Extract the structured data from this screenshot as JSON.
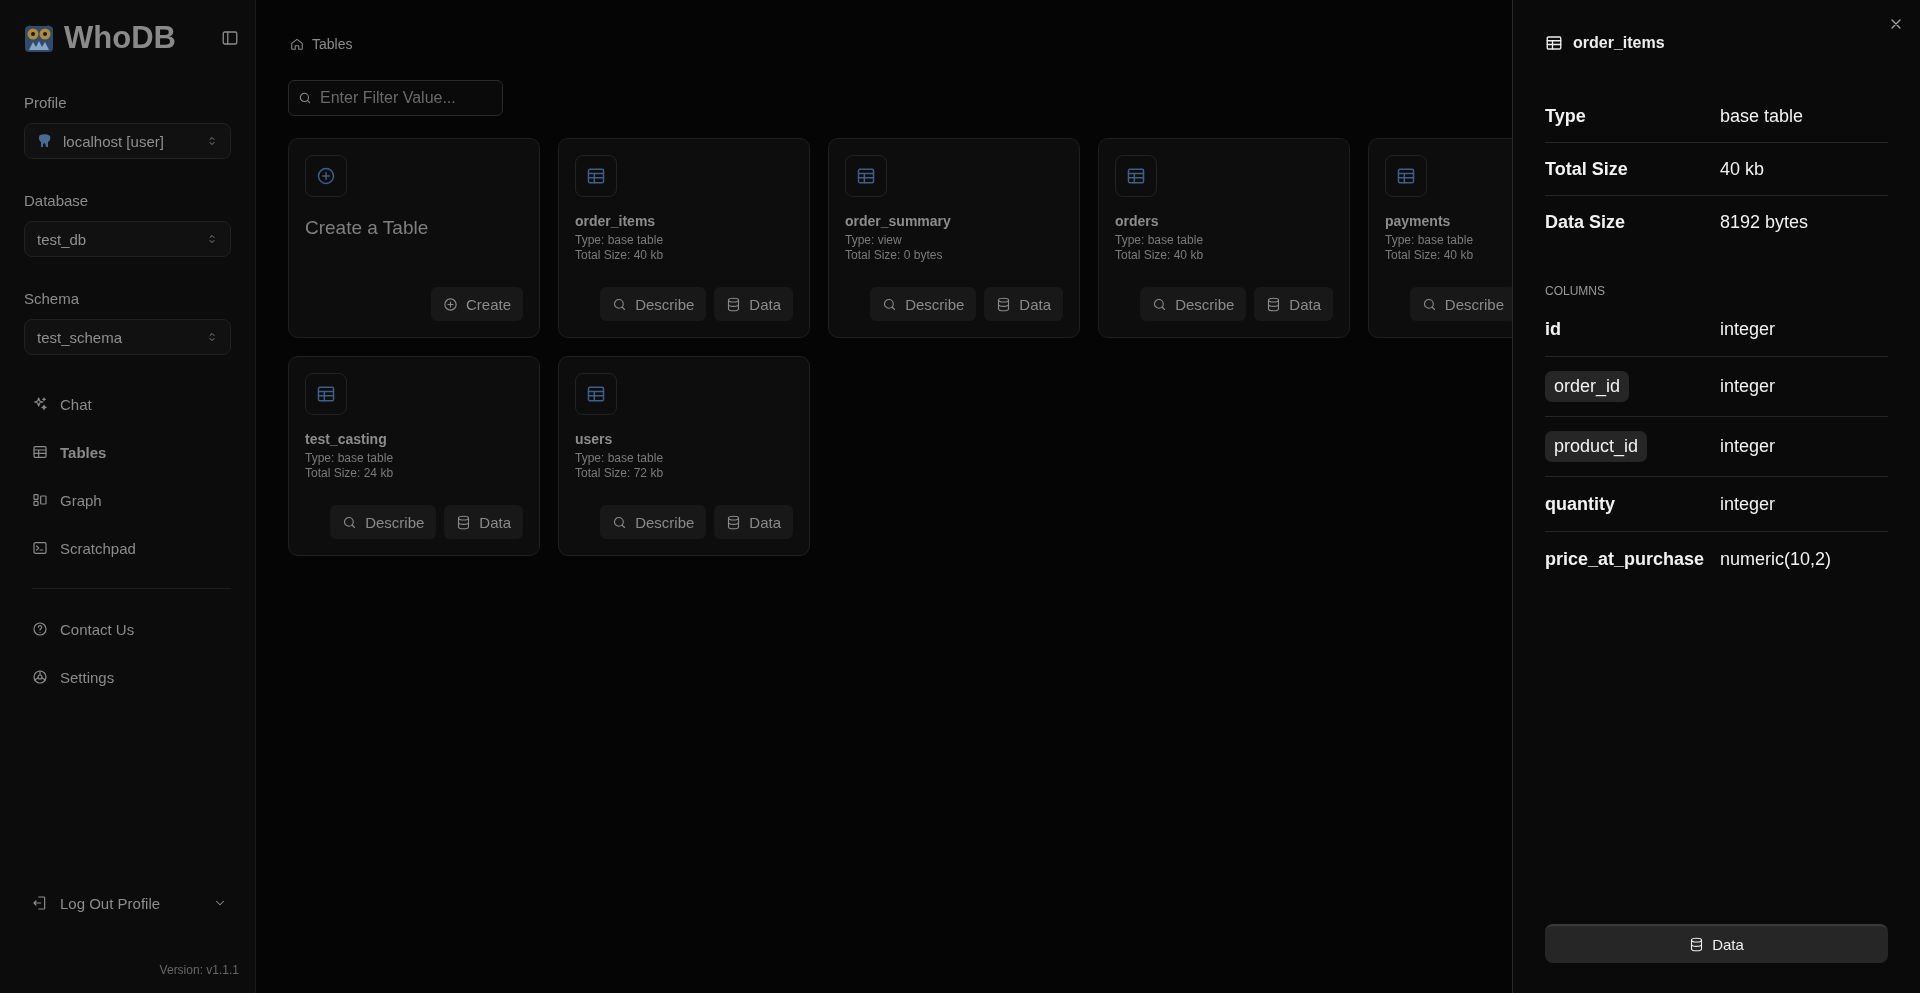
{
  "app": {
    "name": "WhoDB",
    "version": "Version: v1.1.1"
  },
  "sidebar": {
    "selectors": [
      {
        "label": "Profile",
        "value": "localhost [user]",
        "kind": "profile"
      },
      {
        "label": "Database",
        "value": "test_db",
        "kind": "plain"
      },
      {
        "label": "Schema",
        "value": "test_schema",
        "kind": "plain"
      }
    ],
    "nav": [
      {
        "label": "Chat",
        "kind": "chat",
        "selected": false
      },
      {
        "label": "Tables",
        "kind": "tables",
        "selected": true
      },
      {
        "label": "Graph",
        "kind": "graph",
        "selected": false
      },
      {
        "label": "Scratchpad",
        "kind": "scratchpad",
        "selected": false
      }
    ],
    "secondary": [
      {
        "label": "Contact Us",
        "kind": "contact",
        "selected": false
      },
      {
        "label": "Settings",
        "kind": "settings",
        "selected": false
      }
    ],
    "logout": "Log Out Profile"
  },
  "breadcrumb": "Tables",
  "filter": {
    "placeholder": "Enter Filter Value..."
  },
  "create_card": {
    "title": "Create a Table",
    "button": "Create"
  },
  "tables": [
    {
      "name": "order_items",
      "type": "Type: base table",
      "size": "Total Size: 40 kb",
      "describe": "Describe",
      "data": "Data"
    },
    {
      "name": "order_summary",
      "type": "Type: view",
      "size": "Total Size: 0 bytes",
      "describe": "Describe",
      "data": "Data"
    },
    {
      "name": "orders",
      "type": "Type: base table",
      "size": "Total Size: 40 kb",
      "describe": "Describe",
      "data": "Data"
    },
    {
      "name": "payments",
      "type": "Type: base table",
      "size": "Total Size: 40 kb",
      "describe": "Describe"
    },
    {
      "name": "test_casting",
      "type": "Type: base table",
      "size": "Total Size: 24 kb",
      "describe": "Describe",
      "data": "Data"
    },
    {
      "name": "users",
      "type": "Type: base table",
      "size": "Total Size: 72 kb",
      "describe": "Describe",
      "data": "Data"
    }
  ],
  "panel": {
    "title": "order_items",
    "properties": [
      {
        "label": "Type",
        "value": "base table"
      },
      {
        "label": "Total Size",
        "value": "40 kb"
      },
      {
        "label": "Data Size",
        "value": "8192 bytes"
      }
    ],
    "columns_heading": "COLUMNS",
    "columns": [
      {
        "name": "id",
        "type": "integer",
        "key": false
      },
      {
        "name": "order_id",
        "type": "integer",
        "key": true
      },
      {
        "name": "product_id",
        "type": "integer",
        "key": true
      },
      {
        "name": "quantity",
        "type": "integer",
        "key": false
      },
      {
        "name": "price_at_purchase",
        "type": "numeric(10,2)",
        "key": false
      }
    ],
    "button": "Data"
  }
}
